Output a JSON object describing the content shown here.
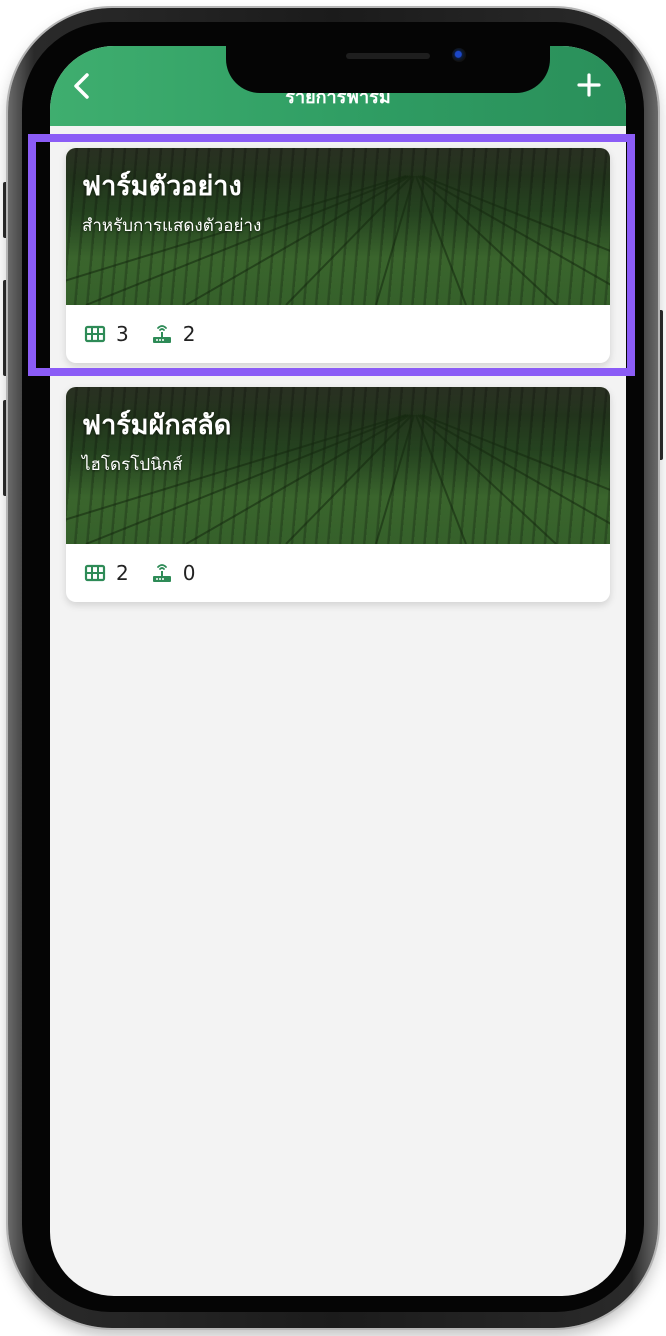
{
  "header": {
    "title": "รายการฟาร์ม",
    "back_icon": "chevron-left-icon",
    "add_icon": "plus-icon",
    "background": "#2f9d63"
  },
  "farms": [
    {
      "name": "ฟาร์มตัวอย่าง",
      "description": "สำหรับการแสดงตัวอย่าง",
      "zones": "3",
      "devices": "2"
    },
    {
      "name": "ฟาร์มผักสลัด",
      "description": "ไฮโดรโปนิกส์",
      "zones": "2",
      "devices": "0"
    }
  ],
  "icons": {
    "zones": "grid-icon",
    "devices": "router-icon"
  },
  "colors": {
    "accent": "#2a8f5a",
    "icon": "#2e8b57",
    "highlight": "#8b5cf6",
    "screen_background": "#f3f3f3"
  }
}
